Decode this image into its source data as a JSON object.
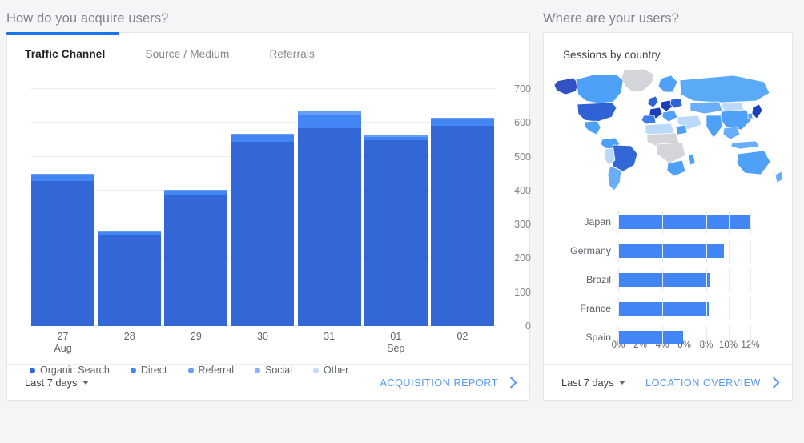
{
  "left_panel": {
    "section_title": "How do you acquire users?",
    "tabs": [
      {
        "label": "Traffic Channel",
        "active": true
      },
      {
        "label": "Source / Medium",
        "active": false
      },
      {
        "label": "Referrals",
        "active": false
      }
    ],
    "footer": {
      "date_range": "Last 7 days",
      "link_label": "ACQUISITION REPORT",
      "chevron_icon": "chevron-right-icon",
      "caret_icon": "caret-down-icon"
    }
  },
  "right_panel": {
    "section_title": "Where are your users?",
    "card_title": "Sessions by country",
    "footer": {
      "date_range": "Last 7 days",
      "link_label": "LOCATION OVERVIEW",
      "chevron_icon": "chevron-right-icon",
      "caret_icon": "caret-down-icon"
    }
  },
  "colors": {
    "accent": "#1a73e8",
    "organic_search": "#3367d6",
    "direct": "#4285f4",
    "referral": "#669df6",
    "social": "#8ab4f8",
    "other": "#c6dafc",
    "link": "#5b9aee",
    "map_no_data": "#d3d5d8",
    "page_bg": "#f4f5f7"
  },
  "chart_data": [
    {
      "type": "bar",
      "id": "acquisition-by-traffic-channel",
      "title": "Traffic Channel",
      "stacked": true,
      "xlabel": "",
      "ylabel": "",
      "ylim": [
        0,
        700
      ],
      "yticks": [
        0,
        100,
        200,
        300,
        400,
        500,
        600,
        700
      ],
      "grid": true,
      "legend_position": "bottom",
      "categories": [
        "27",
        "28",
        "29",
        "30",
        "31",
        "01",
        "02"
      ],
      "category_sublabels": [
        "Aug",
        "",
        "",
        "",
        "",
        "Sep",
        ""
      ],
      "series": [
        {
          "name": "Organic Search",
          "color": "#3367d6",
          "values": [
            428,
            270,
            386,
            545,
            585,
            548,
            592
          ]
        },
        {
          "name": "Direct",
          "color": "#4285f4",
          "values": [
            20,
            9,
            14,
            20,
            40,
            9,
            20
          ]
        },
        {
          "name": "Referral",
          "color": "#669df6",
          "values": [
            2,
            2,
            2,
            2,
            9,
            6,
            3
          ]
        },
        {
          "name": "Social",
          "color": "#8ab4f8",
          "values": [
            0,
            0,
            0,
            0,
            0,
            0,
            0
          ]
        },
        {
          "name": "Other",
          "color": "#c6dafc",
          "values": [
            0,
            0,
            0,
            0,
            0,
            0,
            0
          ]
        }
      ],
      "totals": [
        450,
        281,
        402,
        567,
        634,
        563,
        615
      ]
    },
    {
      "type": "bar",
      "id": "sessions-by-country",
      "title": "Sessions by country",
      "orientation": "horizontal",
      "xlabel": "",
      "ylabel": "",
      "xlim": [
        0,
        12.8
      ],
      "xticks": [
        0,
        2,
        4,
        6,
        8,
        10,
        12
      ],
      "xticklabels": [
        "0%",
        "2%",
        "4%",
        "6%",
        "8%",
        "10%",
        "12%"
      ],
      "grid": true,
      "categories": [
        "Japan",
        "Germany",
        "Brazil",
        "France",
        "Spain"
      ],
      "values": [
        11.9,
        9.6,
        8.3,
        8.2,
        5.9
      ],
      "color": "#4285f4"
    }
  ],
  "map": {
    "name": "world-choropleth-sessions",
    "legend_scale": [
      "#c6dafc",
      "#8ab4f8",
      "#4fa0f7",
      "#3367d6",
      "#1a3fb8"
    ]
  }
}
